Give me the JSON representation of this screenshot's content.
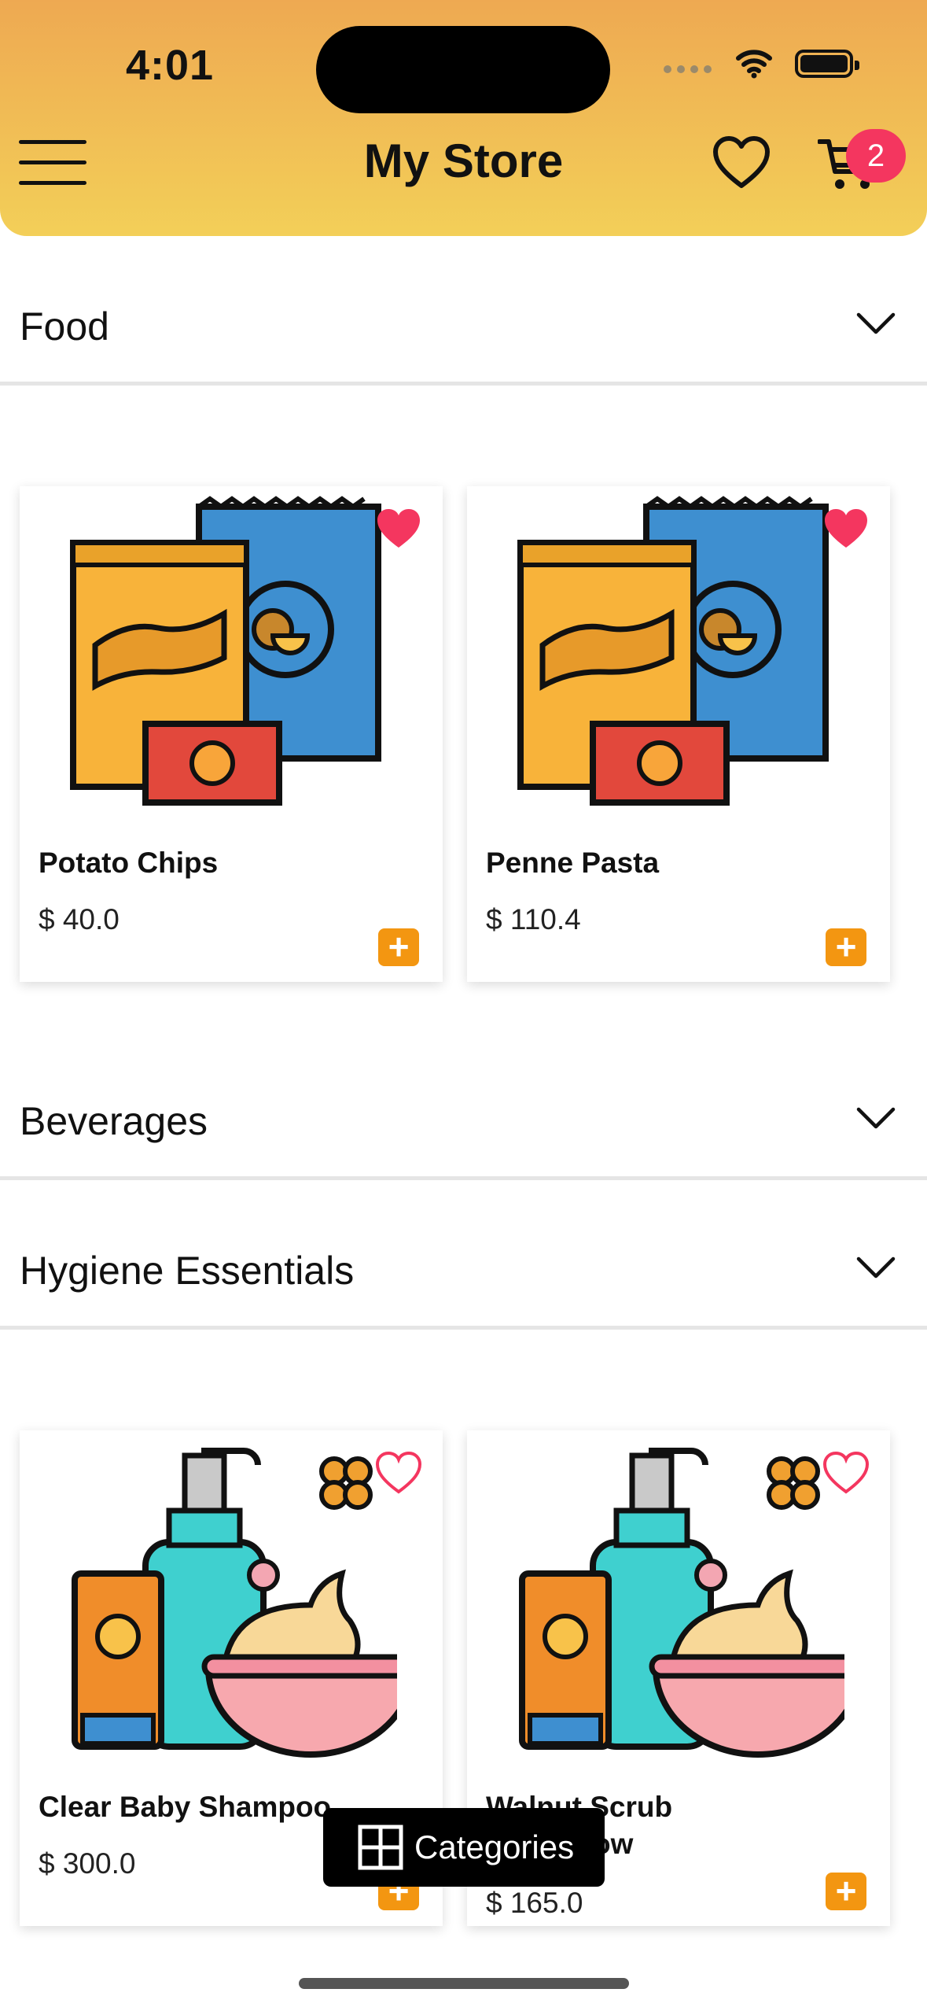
{
  "status": {
    "time": "4:01"
  },
  "header": {
    "title": "My Store",
    "cart_count": "2"
  },
  "categories": [
    {
      "label": "Food"
    },
    {
      "label": "Beverages"
    },
    {
      "label": "Hygiene Essentials"
    }
  ],
  "food_products": [
    {
      "name": "Potato Chips",
      "price": "$ 40.0",
      "favorite": true
    },
    {
      "name": "Penne Pasta",
      "price": "$ 110.4",
      "favorite": true
    }
  ],
  "hygiene_products": [
    {
      "name": "Clear Baby Shampoo",
      "price": "$ 300.0",
      "favorite": false
    },
    {
      "name": "Walnut Scrub",
      "name_line2": "ow",
      "price": "$ 165.0",
      "favorite": false
    }
  ],
  "add_label": "+",
  "categories_button": {
    "label": "Categories"
  },
  "colors": {
    "header_top": "#EEA952",
    "header_bottom": "#F3CF58",
    "accent_add": "#F39611",
    "badge": "#F4365F",
    "favorite": "#F4365F"
  }
}
